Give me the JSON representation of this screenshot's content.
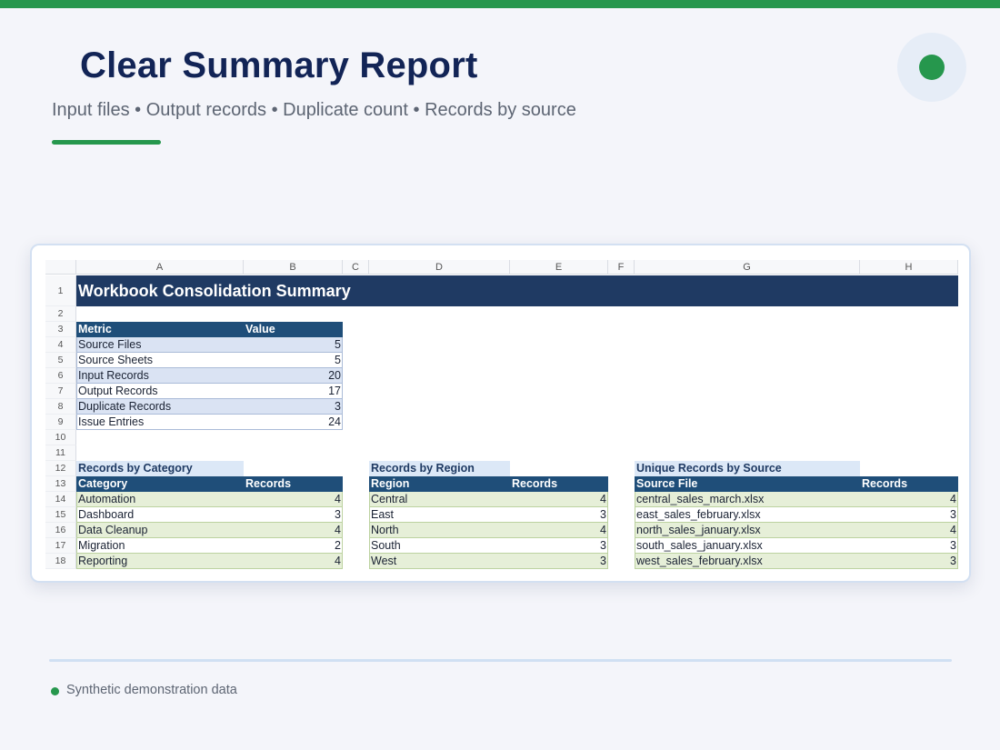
{
  "page": {
    "title": "Clear Summary Report",
    "subtitle": "Input files • Output records • Duplicate count • Records by source",
    "footer": "Synthetic demonstration data",
    "colors": {
      "accent": "#26974d",
      "title": "#122456",
      "banner": "#1f3a63",
      "header": "#1f4e79"
    }
  },
  "sheet": {
    "columns": [
      "A",
      "B",
      "C",
      "D",
      "E",
      "F",
      "G",
      "H"
    ],
    "rows": [
      "1",
      "2",
      "3",
      "4",
      "5",
      "6",
      "7",
      "8",
      "9",
      "10",
      "11",
      "12",
      "13",
      "14",
      "15",
      "16",
      "17",
      "18"
    ],
    "banner": "Workbook Consolidation Summary",
    "metrics": {
      "header": [
        "Metric",
        "Value"
      ],
      "rows": [
        [
          "Source Files",
          "5"
        ],
        [
          "Source Sheets",
          "5"
        ],
        [
          "Input Records",
          "20"
        ],
        [
          "Output Records",
          "17"
        ],
        [
          "Duplicate Records",
          "3"
        ],
        [
          "Issue Entries",
          "24"
        ]
      ]
    },
    "by_category": {
      "title": "Records by Category",
      "header": [
        "Category",
        "Records"
      ],
      "rows": [
        [
          "Automation",
          "4"
        ],
        [
          "Dashboard",
          "3"
        ],
        [
          "Data Cleanup",
          "4"
        ],
        [
          "Migration",
          "2"
        ],
        [
          "Reporting",
          "4"
        ]
      ]
    },
    "by_region": {
      "title": "Records by Region",
      "header": [
        "Region",
        "Records"
      ],
      "rows": [
        [
          "Central",
          "4"
        ],
        [
          "East",
          "3"
        ],
        [
          "North",
          "4"
        ],
        [
          "South",
          "3"
        ],
        [
          "West",
          "3"
        ]
      ]
    },
    "by_source": {
      "title": "Unique Records by Source",
      "header": [
        "Source File",
        "Records"
      ],
      "rows": [
        [
          "central_sales_march.xlsx",
          "4"
        ],
        [
          "east_sales_february.xlsx",
          "3"
        ],
        [
          "north_sales_january.xlsx",
          "4"
        ],
        [
          "south_sales_january.xlsx",
          "3"
        ],
        [
          "west_sales_february.xlsx",
          "3"
        ]
      ]
    }
  }
}
